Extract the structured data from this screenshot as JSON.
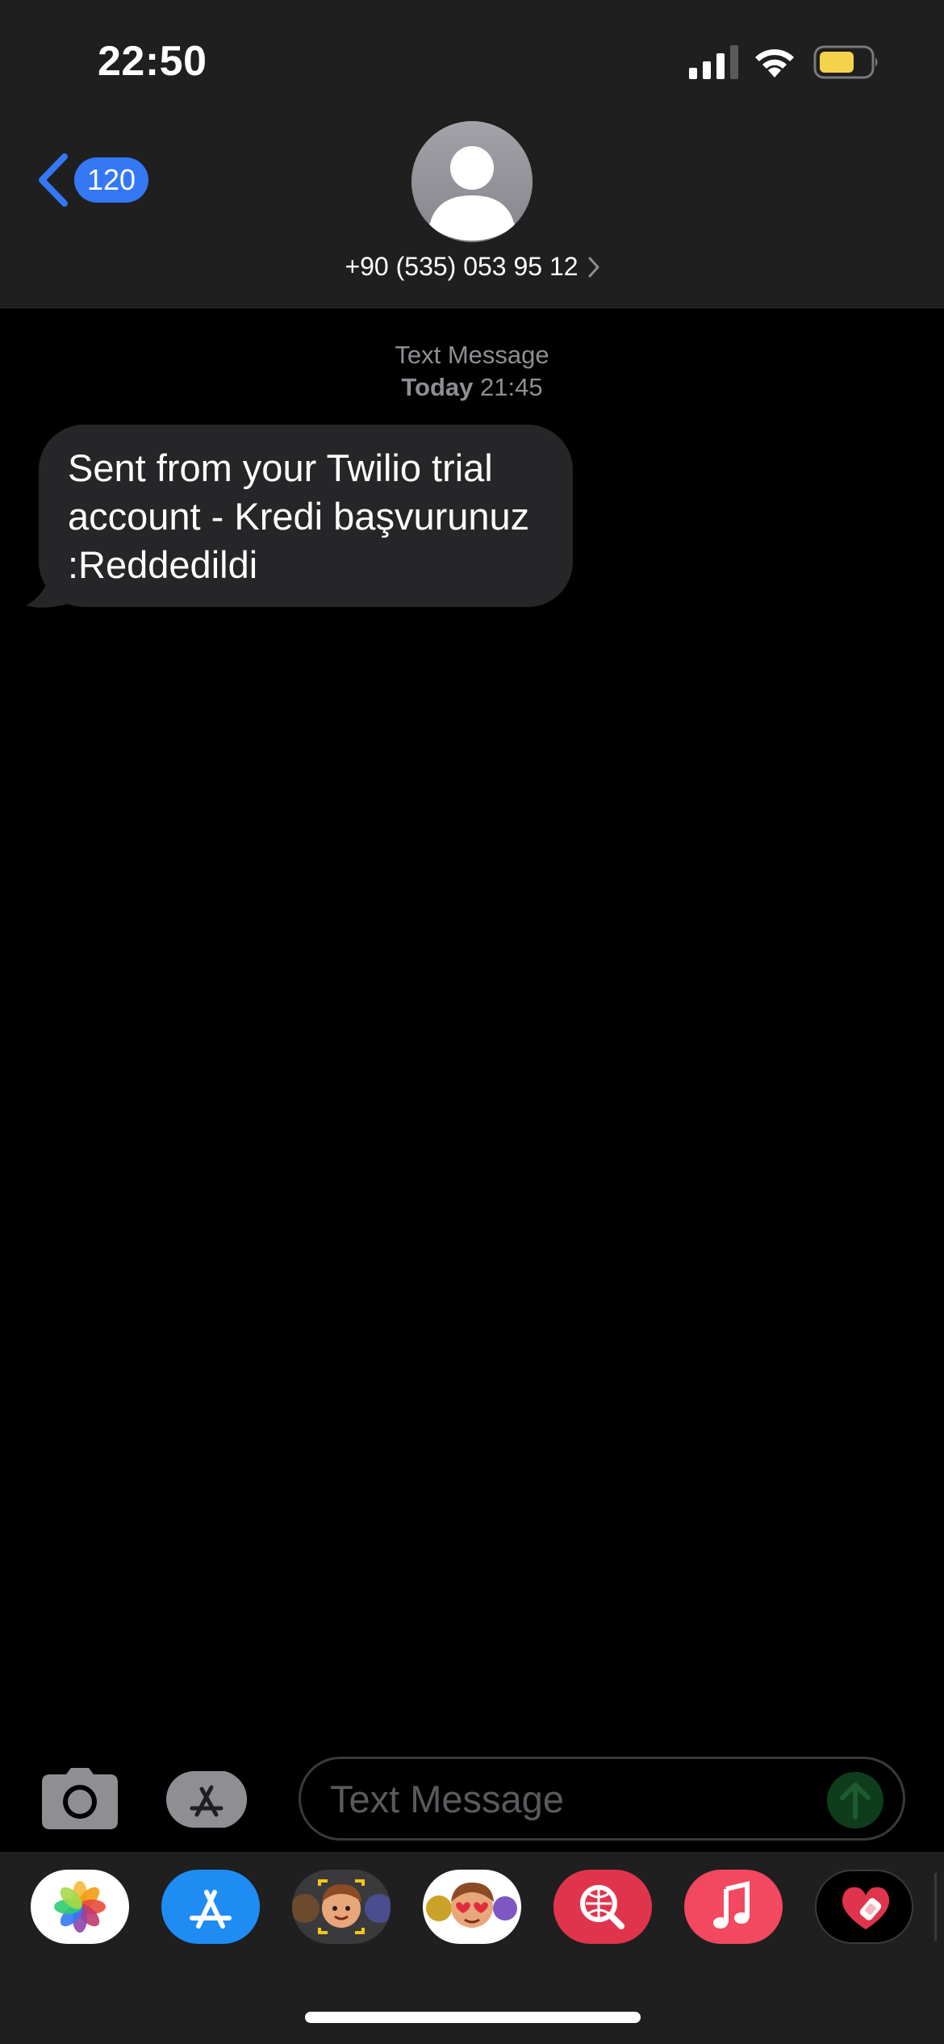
{
  "status_bar": {
    "time": "22:50",
    "icons": [
      "cellular-signal-icon",
      "wifi-icon",
      "battery-icon"
    ],
    "battery_color": "#f5d24b"
  },
  "nav": {
    "back_badge": "120",
    "contact_number": "+90 (535) 053 95 12",
    "accent_color": "#3478f6"
  },
  "conversation": {
    "service_label": "Text Message",
    "day_label": "Today",
    "time_label": "21:45",
    "messages": [
      {
        "direction": "incoming",
        "text": "Sent from your Twilio trial account - Kredi başvurunuz :Reddedildi"
      }
    ]
  },
  "composer": {
    "placeholder": "Text Message",
    "value": ""
  },
  "app_drawer": {
    "apps": [
      "photos-icon",
      "app-store-icon",
      "memoji-camera-icon",
      "memoji-stickers-icon",
      "web-search-icon",
      "music-icon",
      "heart-app-icon"
    ]
  }
}
